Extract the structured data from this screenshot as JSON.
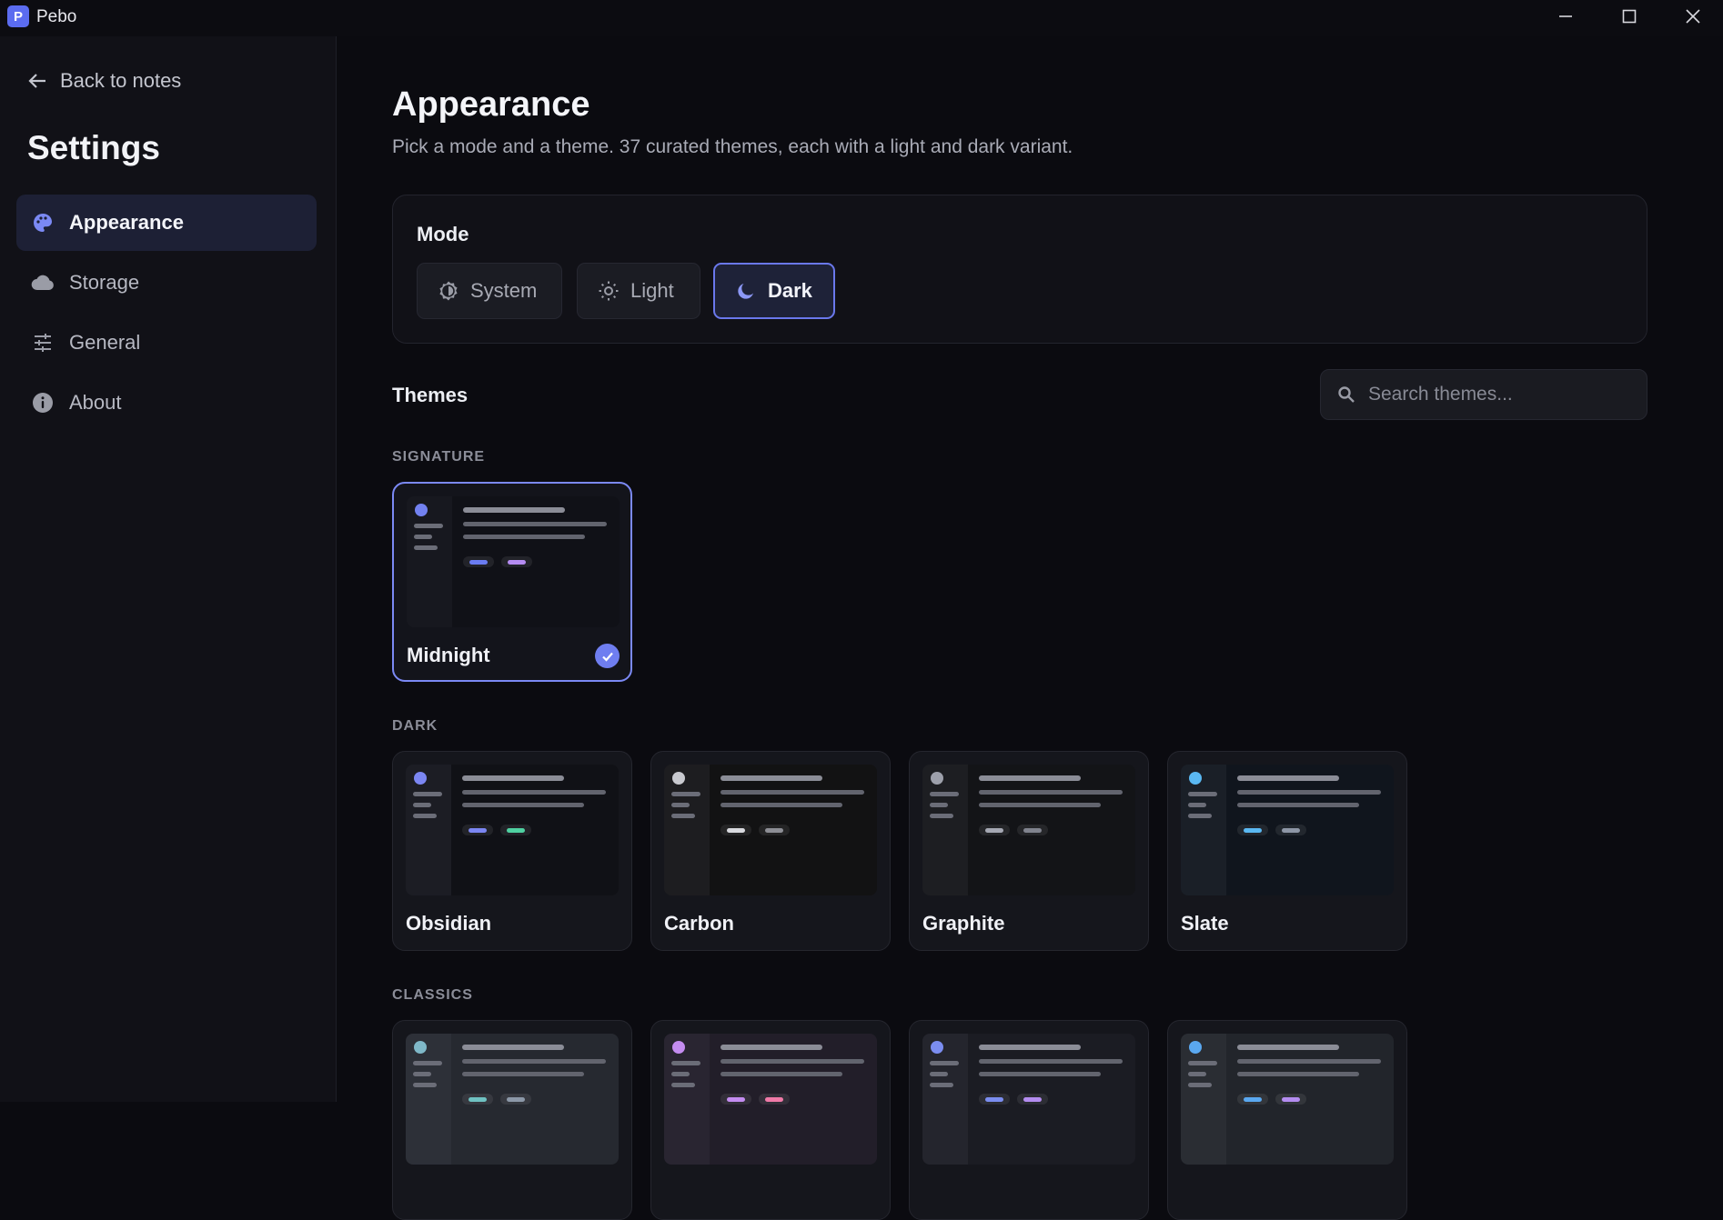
{
  "app": {
    "title": "Pebo",
    "logo_letter": "P"
  },
  "sidebar": {
    "back_label": "Back to notes",
    "title": "Settings",
    "items": [
      {
        "label": "Appearance",
        "icon": "palette-icon",
        "active": true
      },
      {
        "label": "Storage",
        "icon": "cloud-icon",
        "active": false
      },
      {
        "label": "General",
        "icon": "sliders-icon",
        "active": false
      },
      {
        "label": "About",
        "icon": "info-icon",
        "active": false
      }
    ]
  },
  "main": {
    "title": "Appearance",
    "subtitle": "Pick a mode and a theme. 37 curated themes, each with a light and dark variant.",
    "mode": {
      "label": "Mode",
      "options": [
        {
          "label": "System",
          "icon": "system-icon",
          "active": false
        },
        {
          "label": "Light",
          "icon": "sun-icon",
          "active": false
        },
        {
          "label": "Dark",
          "icon": "moon-icon",
          "active": true
        }
      ]
    },
    "themes": {
      "heading": "Themes",
      "search_placeholder": "Search themes...",
      "groups": [
        {
          "label": "SIGNATURE",
          "themes": [
            {
              "name": "Midnight",
              "selected": true,
              "colors": {
                "side": "#17181f",
                "main": "#101117",
                "dot": "#7281f0",
                "pill1": "#6a7cf2",
                "pill2": "#b58cf2"
              }
            }
          ]
        },
        {
          "label": "DARK",
          "themes": [
            {
              "name": "Obsidian",
              "selected": false,
              "colors": {
                "side": "#1c1d24",
                "main": "#101116",
                "dot": "#7b86f2",
                "pill1": "#7b86f2",
                "pill2": "#4fd1a1"
              }
            },
            {
              "name": "Carbon",
              "selected": false,
              "colors": {
                "side": "#1d1d20",
                "main": "#121213",
                "dot": "#c8c9cf",
                "pill1": "#d8d9de",
                "pill2": "#8d8e95"
              }
            },
            {
              "name": "Graphite",
              "selected": false,
              "colors": {
                "side": "#1d1e22",
                "main": "#131417",
                "dot": "#9da0ab",
                "pill1": "#a5a8b3",
                "pill2": "#80838e"
              }
            },
            {
              "name": "Slate",
              "selected": false,
              "colors": {
                "side": "#1a1f27",
                "main": "#10151d",
                "dot": "#5ab8f2",
                "pill1": "#5ab8f2",
                "pill2": "#8d96a6"
              }
            }
          ]
        },
        {
          "label": "CLASSICS",
          "themes": [
            {
              "name": "",
              "selected": false,
              "colors": {
                "side": "#2d3038",
                "main": "#262930",
                "dot": "#7fb8c8",
                "pill1": "#6fc2c2",
                "pill2": "#8c98a8"
              }
            },
            {
              "name": "",
              "selected": false,
              "colors": {
                "side": "#292531",
                "main": "#221e29",
                "dot": "#c48cf0",
                "pill1": "#c48cf0",
                "pill2": "#f07aa8"
              }
            },
            {
              "name": "",
              "selected": false,
              "colors": {
                "side": "#24252d",
                "main": "#1b1c23",
                "dot": "#7b8df0",
                "pill1": "#7b8df0",
                "pill2": "#b48cf0"
              }
            },
            {
              "name": "",
              "selected": false,
              "colors": {
                "side": "#2a2d33",
                "main": "#22252b",
                "dot": "#5aa8f0",
                "pill1": "#5aa8f0",
                "pill2": "#b48cf0"
              }
            }
          ]
        }
      ]
    }
  }
}
